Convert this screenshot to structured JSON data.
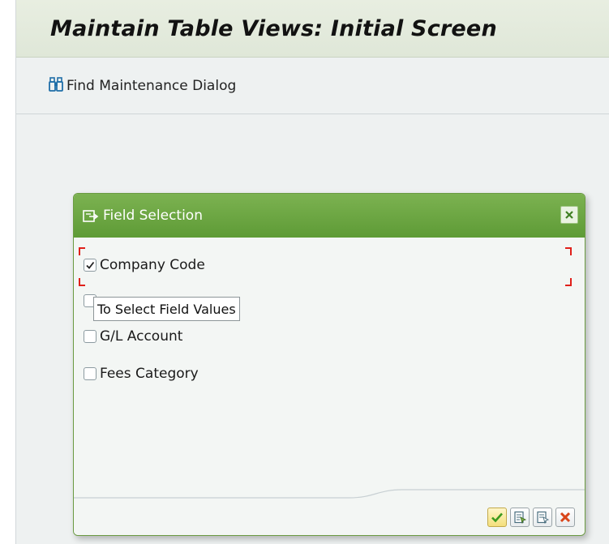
{
  "window": {
    "title": "Maintain Table Views: Initial Screen"
  },
  "toolbar": {
    "find_label": "Find Maintenance Dialog",
    "find_icon": "binoculars-icon"
  },
  "dialog": {
    "title": "Field Selection",
    "icon": "field-selection-icon",
    "tooltip": "To Select Field Values",
    "fields": [
      {
        "label": "Company Code",
        "checked": true
      },
      {
        "label": "",
        "checked": false
      },
      {
        "label": "G/L Account",
        "checked": false
      },
      {
        "label": "Fees Category",
        "checked": false
      }
    ],
    "buttons": [
      {
        "name": "continue-button",
        "icon": "checkmark-icon"
      },
      {
        "name": "select-all-button",
        "icon": "select-all-icon"
      },
      {
        "name": "deselect-all-button",
        "icon": "deselect-all-icon"
      },
      {
        "name": "cancel-button",
        "icon": "cancel-x-icon"
      }
    ]
  },
  "colors": {
    "dialog_header": "#6aa53f",
    "focus_marker": "#e0201a",
    "cancel": "#d9461a",
    "accept": "#f3df7c"
  }
}
